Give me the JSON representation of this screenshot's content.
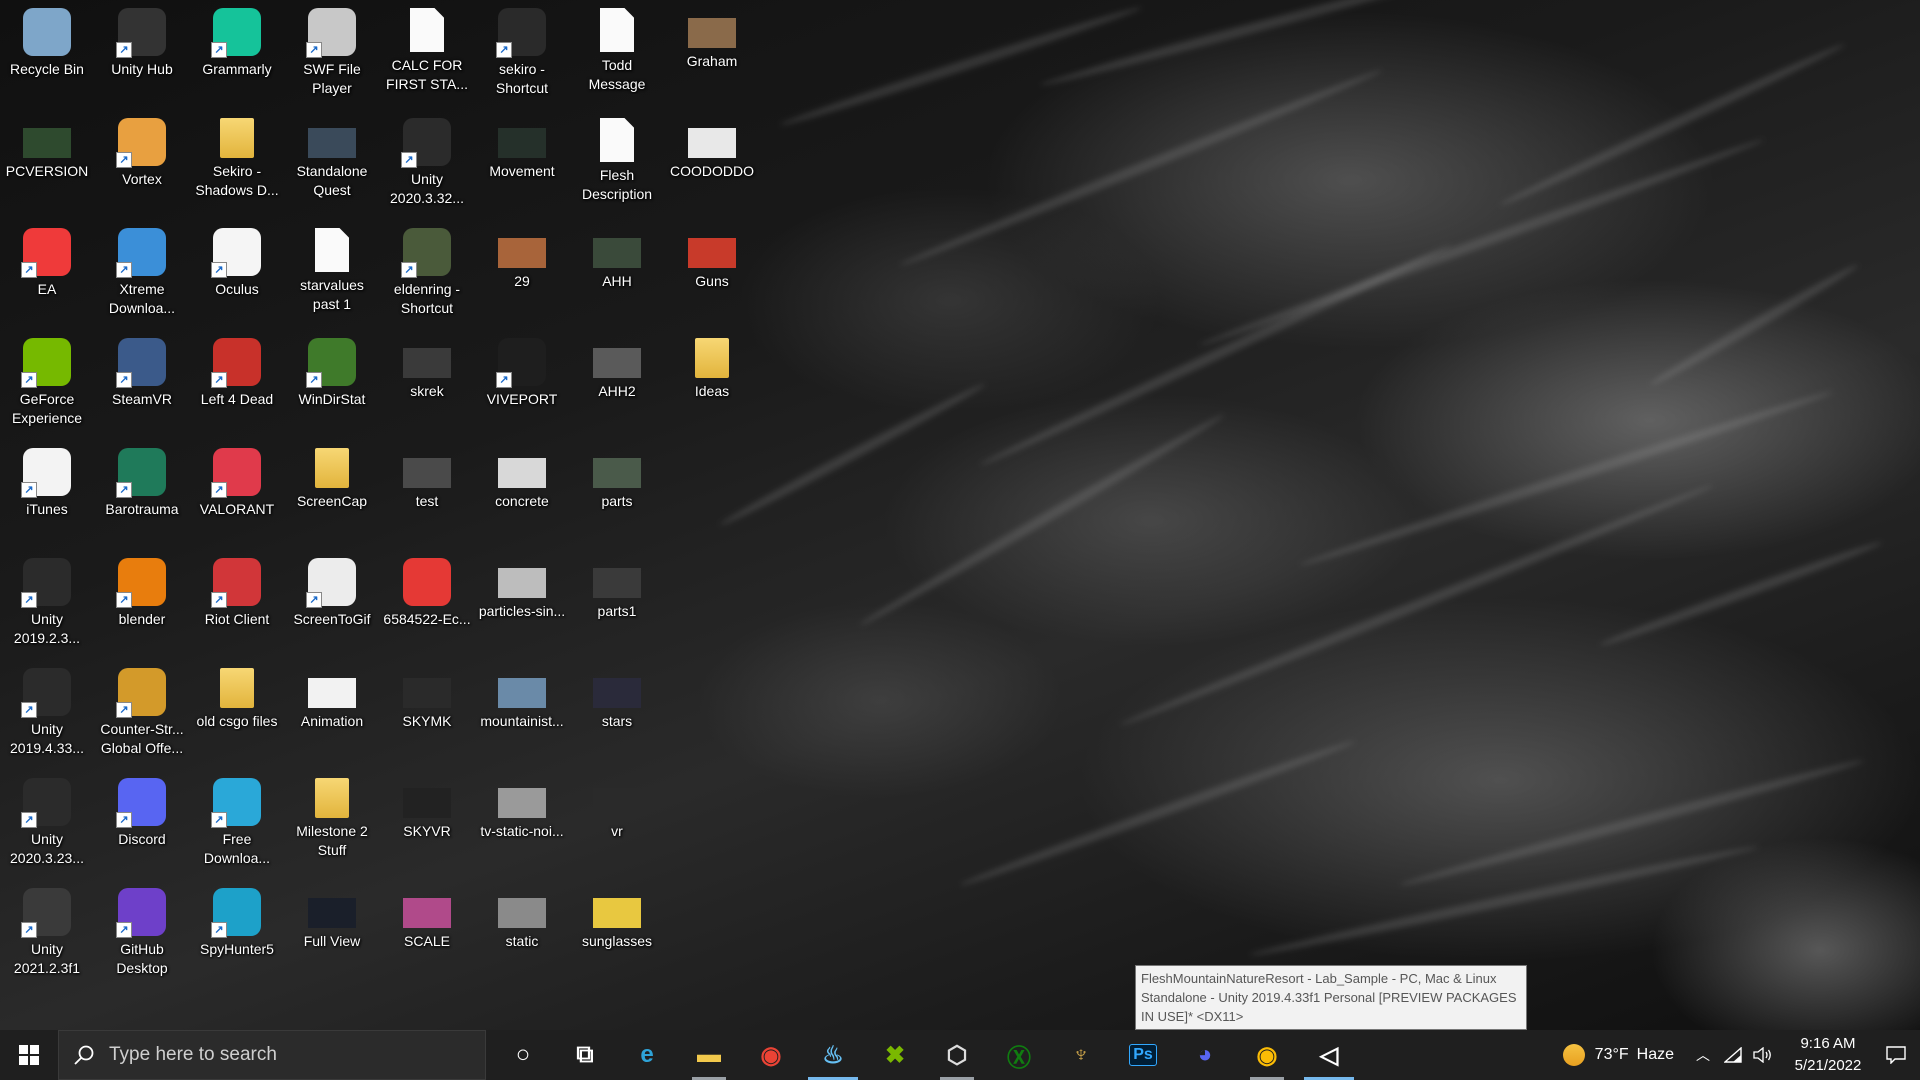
{
  "desktop": {
    "columns": [
      [
        {
          "label": "Recycle Bin",
          "icon": "recycle-bin-icon",
          "kind": "app",
          "color": "#7ea6c9",
          "shortcut": false
        },
        {
          "label": "PCVERSION",
          "icon": "image-thumbnail-icon",
          "kind": "thumb",
          "color": "#2e4a2e",
          "shortcut": false
        },
        {
          "label": "EA",
          "icon": "ea-icon",
          "kind": "app",
          "color": "#ef3a3a",
          "shortcut": true
        },
        {
          "label": "GeForce Experience",
          "icon": "geforce-icon",
          "kind": "app",
          "color": "#76b900",
          "shortcut": true
        },
        {
          "label": "iTunes",
          "icon": "itunes-icon",
          "kind": "app",
          "color": "#f3f3f3",
          "shortcut": true
        },
        {
          "label": "Unity 2019.2.3...",
          "icon": "unity-icon",
          "kind": "app",
          "color": "#2b2b2b",
          "shortcut": true
        },
        {
          "label": "Unity 2019.4.33...",
          "icon": "unity-icon",
          "kind": "app",
          "color": "#2b2b2b",
          "shortcut": true
        },
        {
          "label": "Unity 2020.3.23...",
          "icon": "unity-icon",
          "kind": "app",
          "color": "#2b2b2b",
          "shortcut": true
        },
        {
          "label": "Unity 2021.2.3f1",
          "icon": "unity-icon",
          "kind": "app",
          "color": "#3a3a3a",
          "shortcut": true
        }
      ],
      [
        {
          "label": "Unity Hub",
          "icon": "unity-hub-icon",
          "kind": "app",
          "color": "#333333",
          "shortcut": true
        },
        {
          "label": "Vortex",
          "icon": "vortex-icon",
          "kind": "app",
          "color": "#e8a040",
          "shortcut": true
        },
        {
          "label": "Xtreme Downloa...",
          "icon": "xtreme-download-icon",
          "kind": "app",
          "color": "#3b8fd8",
          "shortcut": true
        },
        {
          "label": "SteamVR",
          "icon": "steamvr-icon",
          "kind": "app",
          "color": "#3b5a8a",
          "shortcut": true
        },
        {
          "label": "Barotrauma",
          "icon": "barotrauma-icon",
          "kind": "app",
          "color": "#1f7a5a",
          "shortcut": true
        },
        {
          "label": "blender",
          "icon": "blender-icon",
          "kind": "app",
          "color": "#e87d0d",
          "shortcut": true
        },
        {
          "label": "Counter-Str... Global Offe...",
          "icon": "csgo-icon",
          "kind": "app",
          "color": "#d39a2a",
          "shortcut": true
        },
        {
          "label": "Discord",
          "icon": "discord-icon",
          "kind": "app",
          "color": "#5865f2",
          "shortcut": true
        },
        {
          "label": "GitHub Desktop",
          "icon": "github-desktop-icon",
          "kind": "app",
          "color": "#6e40c9",
          "shortcut": true
        }
      ],
      [
        {
          "label": "Grammarly",
          "icon": "grammarly-icon",
          "kind": "app",
          "color": "#15c39a",
          "shortcut": true
        },
        {
          "label": "Sekiro - Shadows D...",
          "icon": "folder-icon",
          "kind": "folder",
          "color": "#e9c24e",
          "shortcut": false
        },
        {
          "label": "Oculus",
          "icon": "oculus-icon",
          "kind": "app",
          "color": "#f5f5f5",
          "shortcut": true
        },
        {
          "label": "Left 4 Dead",
          "icon": "left4dead-icon",
          "kind": "app",
          "color": "#c8312a",
          "shortcut": true
        },
        {
          "label": "VALORANT",
          "icon": "valorant-icon",
          "kind": "app",
          "color": "#e03a4b",
          "shortcut": true
        },
        {
          "label": "Riot Client",
          "icon": "riot-client-icon",
          "kind": "app",
          "color": "#d13639",
          "shortcut": true
        },
        {
          "label": "old csgo files",
          "icon": "folder-icon",
          "kind": "folder",
          "color": "#e9c24e",
          "shortcut": false
        },
        {
          "label": "Free Downloa...",
          "icon": "free-download-icon",
          "kind": "app",
          "color": "#2aa8d8",
          "shortcut": true
        },
        {
          "label": "SpyHunter5",
          "icon": "spyhunter-icon",
          "kind": "app",
          "color": "#1da1c9",
          "shortcut": true
        }
      ],
      [
        {
          "label": "SWF File Player",
          "icon": "swf-player-icon",
          "kind": "app",
          "color": "#c8c8c8",
          "shortcut": true
        },
        {
          "label": "Standalone Quest",
          "icon": "image-thumbnail-icon",
          "kind": "thumb",
          "color": "#3a4a5a",
          "shortcut": false
        },
        {
          "label": "starvalues past 1",
          "icon": "document-icon",
          "kind": "doc",
          "color": "#fafafa",
          "shortcut": false
        },
        {
          "label": "WinDirStat",
          "icon": "windirstat-icon",
          "kind": "app",
          "color": "#3f7a2a",
          "shortcut": true
        },
        {
          "label": "ScreenCap",
          "icon": "folder-icon",
          "kind": "folder",
          "color": "#e9c24e",
          "shortcut": false
        },
        {
          "label": "ScreenToGif",
          "icon": "screentogif-icon",
          "kind": "app",
          "color": "#ececec",
          "shortcut": true
        },
        {
          "label": "Animation",
          "icon": "image-thumbnail-icon",
          "kind": "thumb",
          "color": "#f2f2f2",
          "shortcut": false
        },
        {
          "label": "Milestone 2 Stuff",
          "icon": "folder-icon",
          "kind": "folder",
          "color": "#d9b24a",
          "shortcut": false
        },
        {
          "label": "Full View",
          "icon": "image-thumbnail-icon",
          "kind": "thumb",
          "color": "#1a1f2a",
          "shortcut": false
        }
      ],
      [
        {
          "label": "CALC FOR FIRST STA...",
          "icon": "document-icon",
          "kind": "doc",
          "color": "#fafafa",
          "shortcut": false
        },
        {
          "label": "Unity 2020.3.32...",
          "icon": "unity-icon",
          "kind": "app",
          "color": "#2b2b2b",
          "shortcut": true
        },
        {
          "label": "eldenring - Shortcut",
          "icon": "eldenring-icon",
          "kind": "app",
          "color": "#4a5a3a",
          "shortcut": true
        },
        {
          "label": "skrek",
          "icon": "image-thumbnail-icon",
          "kind": "thumb",
          "color": "#3a3a3a",
          "shortcut": false
        },
        {
          "label": "test",
          "icon": "image-thumbnail-icon",
          "kind": "thumb",
          "color": "#4a4a4a",
          "shortcut": false
        },
        {
          "label": "6584522-Ec...",
          "icon": "pdf-icon",
          "kind": "app",
          "color": "#e53935",
          "shortcut": false
        },
        {
          "label": "SKYMK",
          "icon": "image-thumbnail-icon",
          "kind": "thumb",
          "color": "#2a2a2a",
          "shortcut": false
        },
        {
          "label": "SKYVR",
          "icon": "image-thumbnail-icon",
          "kind": "thumb",
          "color": "#222222",
          "shortcut": false
        },
        {
          "label": "SCALE",
          "icon": "image-thumbnail-icon",
          "kind": "thumb",
          "color": "#b04a8a",
          "shortcut": false
        }
      ],
      [
        {
          "label": "sekiro - Shortcut",
          "icon": "sekiro-icon",
          "kind": "app",
          "color": "#2a2a2a",
          "shortcut": true
        },
        {
          "label": "Movement",
          "icon": "image-thumbnail-icon",
          "kind": "thumb",
          "color": "#25302a",
          "shortcut": false
        },
        {
          "label": "29",
          "icon": "image-thumbnail-icon",
          "kind": "thumb",
          "color": "#a8643a",
          "shortcut": false
        },
        {
          "label": "VIVEPORT",
          "icon": "viveport-icon",
          "kind": "app",
          "color": "#1e1e1e",
          "shortcut": true
        },
        {
          "label": "concrete",
          "icon": "image-thumbnail-icon",
          "kind": "thumb",
          "color": "#d8d8d8",
          "shortcut": false
        },
        {
          "label": "particles-sin...",
          "icon": "image-thumbnail-icon",
          "kind": "thumb",
          "color": "#bdbdbd",
          "shortcut": false
        },
        {
          "label": "mountainist...",
          "icon": "image-thumbnail-icon",
          "kind": "thumb",
          "color": "#6a8aa8",
          "shortcut": false
        },
        {
          "label": "tv-static-noi...",
          "icon": "image-thumbnail-icon",
          "kind": "thumb",
          "color": "#9a9a9a",
          "shortcut": false
        },
        {
          "label": "static",
          "icon": "image-thumbnail-icon",
          "kind": "thumb",
          "color": "#8a8a8a",
          "shortcut": false
        }
      ],
      [
        {
          "label": "Todd Message",
          "icon": "document-icon",
          "kind": "doc",
          "color": "#fafafa",
          "shortcut": false
        },
        {
          "label": "Flesh Description",
          "icon": "document-icon",
          "kind": "doc",
          "color": "#fafafa",
          "shortcut": false
        },
        {
          "label": "AHH",
          "icon": "image-thumbnail-icon",
          "kind": "thumb",
          "color": "#3a4a3a",
          "shortcut": false
        },
        {
          "label": "AHH2",
          "icon": "image-thumbnail-icon",
          "kind": "thumb",
          "color": "#5a5a5a",
          "shortcut": false
        },
        {
          "label": "parts",
          "icon": "image-thumbnail-icon",
          "kind": "thumb",
          "color": "#4a5a4a",
          "shortcut": false
        },
        {
          "label": "parts1",
          "icon": "image-thumbnail-icon",
          "kind": "thumb",
          "color": "#3a3a3a",
          "shortcut": false
        },
        {
          "label": "stars",
          "icon": "image-thumbnail-icon",
          "kind": "thumb",
          "color": "#2a2a3a",
          "shortcut": false
        },
        {
          "label": "vr",
          "icon": "image-thumbnail-icon",
          "kind": "thumb",
          "color": "#2a2a2a",
          "shortcut": false
        },
        {
          "label": "sunglasses",
          "icon": "image-thumbnail-icon",
          "kind": "thumb",
          "color": "#e8c840",
          "shortcut": false
        }
      ],
      [
        {
          "label": "Graham",
          "icon": "image-thumbnail-icon",
          "kind": "thumb",
          "color": "#8a6a4a",
          "shortcut": false
        },
        {
          "label": "COODODDO",
          "icon": "image-thumbnail-icon",
          "kind": "thumb",
          "color": "#e8e8e8",
          "shortcut": false
        },
        {
          "label": "Guns",
          "icon": "image-thumbnail-icon",
          "kind": "thumb",
          "color": "#c83a2a",
          "shortcut": false
        },
        {
          "label": "Ideas",
          "icon": "folder-icon",
          "kind": "folder",
          "color": "#e9c24e",
          "shortcut": false
        }
      ]
    ]
  },
  "tooltip": {
    "text": "FleshMountainNatureResort - Lab_Sample - PC, Mac & Linux Standalone - Unity 2019.4.33f1 Personal [PREVIEW PACKAGES IN USE]* <DX11>"
  },
  "taskbar": {
    "search_placeholder": "Type here to search",
    "pinned": [
      {
        "name": "cortana-icon",
        "glyph": "○",
        "color": "#ffffff",
        "state": ""
      },
      {
        "name": "task-view-icon",
        "glyph": "⧉",
        "color": "#ffffff",
        "state": ""
      },
      {
        "name": "edge-icon",
        "glyph": "e",
        "color": "#2ea3d8",
        "state": ""
      },
      {
        "name": "file-explorer-icon",
        "glyph": "▬",
        "color": "#f2c94c",
        "state": "open"
      },
      {
        "name": "chrome-icon",
        "glyph": "◉",
        "color": "#ea4335",
        "state": ""
      },
      {
        "name": "steam-icon",
        "glyph": "♨",
        "color": "#66c0f4",
        "state": "active"
      },
      {
        "name": "xbox-game-bar-icon",
        "glyph": "✖",
        "color": "#7ab800",
        "state": ""
      },
      {
        "name": "unity-hub-icon",
        "glyph": "⬡",
        "color": "#dddddd",
        "state": "open"
      },
      {
        "name": "xbox-icon",
        "glyph": "Ⓧ",
        "color": "#107c10",
        "state": ""
      },
      {
        "name": "eldenring-icon",
        "glyph": "♆",
        "color": "#c9a24a",
        "state": ""
      },
      {
        "name": "photoshop-icon",
        "glyph": "Ps",
        "color": "#31a8ff",
        "state": ""
      },
      {
        "name": "discord-icon",
        "glyph": "◕",
        "color": "#5865f2",
        "state": ""
      },
      {
        "name": "chrome-profile-icon",
        "glyph": "◉",
        "color": "#fbbc05",
        "state": "open"
      },
      {
        "name": "unity-editor-icon",
        "glyph": "◁",
        "color": "#ffffff",
        "state": "active"
      }
    ],
    "weather": {
      "temp": "73°F",
      "condition": "Haze"
    },
    "time": "9:16 AM",
    "date": "5/21/2022"
  }
}
